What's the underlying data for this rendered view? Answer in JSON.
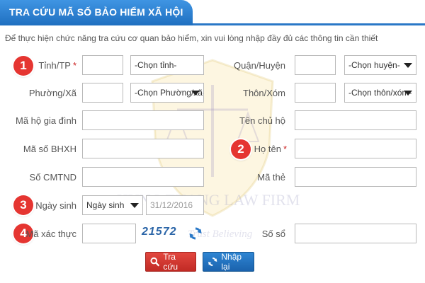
{
  "header": {
    "title": "TRA CỨU MÃ SỐ BẢO HIỂM XÃ HỘI"
  },
  "intro_text": "Để thực hiện chức năng tra cứu cơ quan bảo hiểm, xin vui lòng nhập đầy đủ các thông tin cần thiết",
  "badges": [
    "1",
    "2",
    "3",
    "4"
  ],
  "labels": {
    "tinh": "Tỉnh/TP",
    "quan": "Quận/Huyện",
    "phuong": "Phường/Xã",
    "thon": "Thôn/Xóm",
    "ma_ho": "Mã hộ gia đình",
    "chu_ho": "Tên chủ hộ",
    "ma_bhxh": "Mã số BHXH",
    "ho_ten": "Họ tên",
    "cmtnd": "Số CMTND",
    "ma_the": "Mã thẻ",
    "ngay_sinh": "Ngày sinh",
    "ma_xac_thuc": "Mã xác thực",
    "so_so": "Số sổ",
    "required_mark": "*"
  },
  "selects": {
    "tinh": "-Chọn tỉnh-",
    "huyen": "-Chọn huyện-",
    "phuong": "-Chọn Phường/xã-",
    "thon": "-Chọn thôn/xóm-",
    "ngay_sinh_type": "Ngày sinh"
  },
  "date_value": "31/12/2016",
  "captcha": "21572",
  "buttons": {
    "search": "Tra cứu",
    "reset": "Nhập lại"
  },
  "watermark": {
    "line1": "HUNG THANG LAW FIRM",
    "line2": "Trust Believing"
  },
  "colors": {
    "header_blue": "#2a78c7",
    "badge_red": "#e53531",
    "required_red": "#cc2222"
  }
}
